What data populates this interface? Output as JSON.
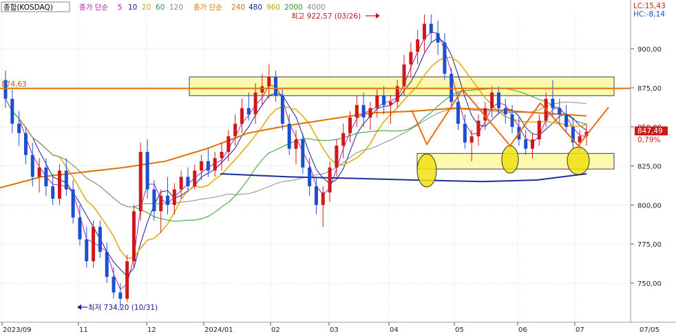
{
  "legend": {
    "index_name": "종합(KOSDAQ)",
    "ma_group1_label": "종가 단순",
    "ma_group1_periods": [
      {
        "text": "5",
        "color": "#b01cb0"
      },
      {
        "text": "10",
        "color": "#1a1a9e"
      },
      {
        "text": "20",
        "color": "#e0a800"
      },
      {
        "text": "60",
        "color": "#2e9a2e"
      },
      {
        "text": "120",
        "color": "#8a8a8a"
      }
    ],
    "ma_group2_label": "종가 단순",
    "ma_group2_periods": [
      {
        "text": "240",
        "color": "#e07000"
      },
      {
        "text": "480",
        "color": "#1a1a9e"
      },
      {
        "text": "960",
        "color": "#c8a000"
      },
      {
        "text": "2000",
        "color": "#2e9a2e"
      },
      {
        "text": "4000",
        "color": "#8a8a8a"
      }
    ]
  },
  "corner": {
    "lc": "LC:15,43",
    "hc": "HC:-8,14"
  },
  "annotations": {
    "high": "최고 922,57 (03/26)",
    "low": "최저 734,20 (10/31)",
    "hline_value": "874,63"
  },
  "price_tag": {
    "price": "847,49",
    "change": "0,79%"
  },
  "chart_data": {
    "type": "candlestick",
    "title": "종합(KOSDAQ)",
    "ylim": [
      725,
      935
    ],
    "y_ticks": [
      "900,00",
      "875,00",
      "850,00",
      "825,00",
      "800,00",
      "775,00",
      "750,00"
    ],
    "x_ticks": [
      "2023/09",
      "11",
      "12",
      "2024/01",
      "02",
      "03",
      "04",
      "05",
      "06",
      "07",
      "07/05"
    ],
    "y_tick_values": [
      900,
      875,
      850,
      825,
      800,
      775,
      750
    ],
    "high": {
      "value": 922.57,
      "date": "03/26"
    },
    "low": {
      "value": 734.2,
      "date": "10/31"
    },
    "last": {
      "close": 847.49,
      "change_pct": 0.79
    },
    "horizontal_line": 874.63,
    "resistance_zone": [
      870,
      882
    ],
    "support_zone": [
      823,
      833
    ],
    "ma240_series_approx": [
      [
        0,
        811
      ],
      [
        60,
        818
      ],
      [
        120,
        821
      ],
      [
        180,
        824
      ],
      [
        240,
        828
      ],
      [
        300,
        836
      ],
      [
        360,
        846
      ],
      [
        420,
        851
      ],
      [
        480,
        855
      ],
      [
        540,
        859
      ],
      [
        600,
        860
      ],
      [
        660,
        862
      ],
      [
        720,
        861
      ],
      [
        780,
        859
      ],
      [
        820,
        858
      ],
      [
        852,
        857
      ]
    ],
    "ma480_series_approx": [
      [
        320,
        820
      ],
      [
        420,
        818
      ],
      [
        520,
        817
      ],
      [
        600,
        816
      ],
      [
        700,
        815
      ],
      [
        780,
        816
      ],
      [
        852,
        820
      ]
    ],
    "candles": [
      {
        "o": 880,
        "h": 886,
        "l": 862,
        "c": 868
      },
      {
        "o": 868,
        "h": 874,
        "l": 846,
        "c": 852
      },
      {
        "o": 852,
        "h": 860,
        "l": 838,
        "c": 846
      },
      {
        "o": 846,
        "h": 850,
        "l": 826,
        "c": 832
      },
      {
        "o": 832,
        "h": 840,
        "l": 812,
        "c": 818
      },
      {
        "o": 818,
        "h": 830,
        "l": 808,
        "c": 824
      },
      {
        "o": 824,
        "h": 830,
        "l": 806,
        "c": 812
      },
      {
        "o": 812,
        "h": 820,
        "l": 800,
        "c": 804
      },
      {
        "o": 804,
        "h": 826,
        "l": 800,
        "c": 822
      },
      {
        "o": 822,
        "h": 830,
        "l": 806,
        "c": 810
      },
      {
        "o": 810,
        "h": 816,
        "l": 788,
        "c": 792
      },
      {
        "o": 792,
        "h": 800,
        "l": 774,
        "c": 778
      },
      {
        "o": 778,
        "h": 786,
        "l": 760,
        "c": 764
      },
      {
        "o": 764,
        "h": 790,
        "l": 760,
        "c": 786
      },
      {
        "o": 786,
        "h": 790,
        "l": 766,
        "c": 770
      },
      {
        "o": 770,
        "h": 776,
        "l": 750,
        "c": 754
      },
      {
        "o": 754,
        "h": 760,
        "l": 740,
        "c": 744
      },
      {
        "o": 744,
        "h": 750,
        "l": 734,
        "c": 740
      },
      {
        "o": 740,
        "h": 768,
        "l": 738,
        "c": 764
      },
      {
        "o": 764,
        "h": 800,
        "l": 760,
        "c": 796
      },
      {
        "o": 796,
        "h": 840,
        "l": 790,
        "c": 834
      },
      {
        "o": 834,
        "h": 842,
        "l": 804,
        "c": 810
      },
      {
        "o": 810,
        "h": 816,
        "l": 790,
        "c": 796
      },
      {
        "o": 796,
        "h": 810,
        "l": 782,
        "c": 806
      },
      {
        "o": 806,
        "h": 818,
        "l": 794,
        "c": 800
      },
      {
        "o": 800,
        "h": 814,
        "l": 794,
        "c": 810
      },
      {
        "o": 810,
        "h": 822,
        "l": 804,
        "c": 818
      },
      {
        "o": 818,
        "h": 824,
        "l": 808,
        "c": 812
      },
      {
        "o": 812,
        "h": 826,
        "l": 810,
        "c": 822
      },
      {
        "o": 822,
        "h": 832,
        "l": 816,
        "c": 828
      },
      {
        "o": 828,
        "h": 836,
        "l": 818,
        "c": 822
      },
      {
        "o": 822,
        "h": 834,
        "l": 818,
        "c": 830
      },
      {
        "o": 830,
        "h": 840,
        "l": 822,
        "c": 834
      },
      {
        "o": 834,
        "h": 848,
        "l": 828,
        "c": 844
      },
      {
        "o": 844,
        "h": 858,
        "l": 838,
        "c": 852
      },
      {
        "o": 852,
        "h": 868,
        "l": 846,
        "c": 862
      },
      {
        "o": 862,
        "h": 872,
        "l": 854,
        "c": 858
      },
      {
        "o": 858,
        "h": 878,
        "l": 852,
        "c": 872
      },
      {
        "o": 872,
        "h": 884,
        "l": 864,
        "c": 876
      },
      {
        "o": 876,
        "h": 890,
        "l": 868,
        "c": 882
      },
      {
        "o": 882,
        "h": 886,
        "l": 866,
        "c": 870
      },
      {
        "o": 870,
        "h": 874,
        "l": 848,
        "c": 852
      },
      {
        "o": 852,
        "h": 858,
        "l": 832,
        "c": 836
      },
      {
        "o": 836,
        "h": 848,
        "l": 826,
        "c": 842
      },
      {
        "o": 842,
        "h": 846,
        "l": 820,
        "c": 824
      },
      {
        "o": 824,
        "h": 830,
        "l": 806,
        "c": 812
      },
      {
        "o": 812,
        "h": 818,
        "l": 794,
        "c": 800
      },
      {
        "o": 800,
        "h": 812,
        "l": 786,
        "c": 808
      },
      {
        "o": 808,
        "h": 828,
        "l": 802,
        "c": 824
      },
      {
        "o": 824,
        "h": 842,
        "l": 818,
        "c": 838
      },
      {
        "o": 838,
        "h": 852,
        "l": 830,
        "c": 846
      },
      {
        "o": 846,
        "h": 860,
        "l": 840,
        "c": 856
      },
      {
        "o": 856,
        "h": 870,
        "l": 850,
        "c": 864
      },
      {
        "o": 864,
        "h": 872,
        "l": 850,
        "c": 856
      },
      {
        "o": 856,
        "h": 866,
        "l": 848,
        "c": 862
      },
      {
        "o": 862,
        "h": 874,
        "l": 856,
        "c": 870
      },
      {
        "o": 870,
        "h": 876,
        "l": 858,
        "c": 864
      },
      {
        "o": 864,
        "h": 870,
        "l": 852,
        "c": 866
      },
      {
        "o": 866,
        "h": 880,
        "l": 862,
        "c": 876
      },
      {
        "o": 876,
        "h": 896,
        "l": 870,
        "c": 890
      },
      {
        "o": 890,
        "h": 904,
        "l": 882,
        "c": 898
      },
      {
        "o": 898,
        "h": 912,
        "l": 890,
        "c": 906
      },
      {
        "o": 906,
        "h": 922,
        "l": 898,
        "c": 916
      },
      {
        "o": 916,
        "h": 922,
        "l": 904,
        "c": 910
      },
      {
        "o": 910,
        "h": 918,
        "l": 896,
        "c": 904
      },
      {
        "o": 904,
        "h": 910,
        "l": 880,
        "c": 884
      },
      {
        "o": 884,
        "h": 888,
        "l": 862,
        "c": 866
      },
      {
        "o": 866,
        "h": 872,
        "l": 848,
        "c": 852
      },
      {
        "o": 852,
        "h": 858,
        "l": 836,
        "c": 840
      },
      {
        "o": 840,
        "h": 848,
        "l": 828,
        "c": 844
      },
      {
        "o": 844,
        "h": 858,
        "l": 838,
        "c": 854
      },
      {
        "o": 854,
        "h": 866,
        "l": 848,
        "c": 862
      },
      {
        "o": 862,
        "h": 876,
        "l": 856,
        "c": 872
      },
      {
        "o": 872,
        "h": 876,
        "l": 858,
        "c": 862
      },
      {
        "o": 862,
        "h": 868,
        "l": 852,
        "c": 858
      },
      {
        "o": 858,
        "h": 864,
        "l": 846,
        "c": 850
      },
      {
        "o": 850,
        "h": 856,
        "l": 838,
        "c": 842
      },
      {
        "o": 842,
        "h": 848,
        "l": 832,
        "c": 836
      },
      {
        "o": 836,
        "h": 846,
        "l": 830,
        "c": 842
      },
      {
        "o": 842,
        "h": 858,
        "l": 838,
        "c": 854
      },
      {
        "o": 854,
        "h": 872,
        "l": 850,
        "c": 868
      },
      {
        "o": 868,
        "h": 880,
        "l": 856,
        "c": 862
      },
      {
        "o": 862,
        "h": 868,
        "l": 852,
        "c": 858
      },
      {
        "o": 858,
        "h": 864,
        "l": 846,
        "c": 850
      },
      {
        "o": 850,
        "h": 856,
        "l": 836,
        "c": 840
      },
      {
        "o": 840,
        "h": 848,
        "l": 834,
        "c": 844
      },
      {
        "o": 844,
        "h": 852,
        "l": 838,
        "c": 847
      }
    ]
  }
}
